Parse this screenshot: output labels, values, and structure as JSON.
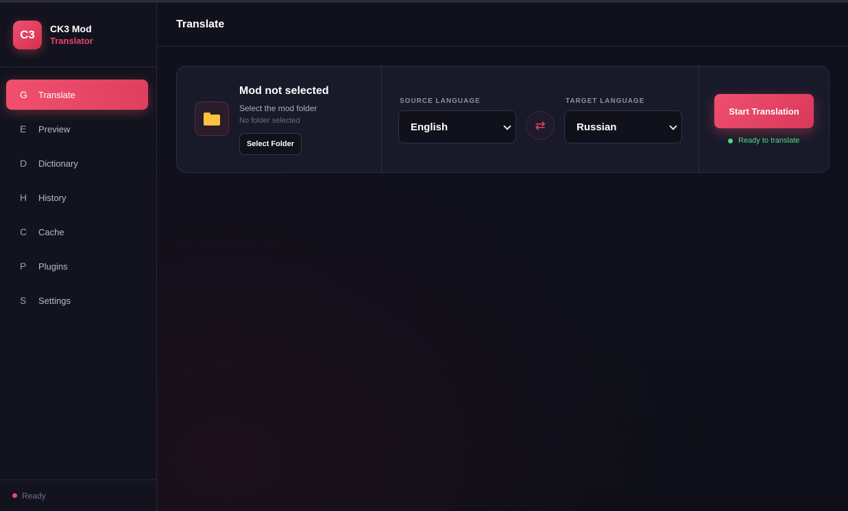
{
  "brand": {
    "logo_text": "C3",
    "name": "CK3 Mod",
    "subtitle": "Translator"
  },
  "nav": {
    "items": [
      {
        "icon": "G",
        "label": "Translate",
        "active": true
      },
      {
        "icon": "E",
        "label": "Preview"
      },
      {
        "icon": "D",
        "label": "Dictionary"
      },
      {
        "icon": "H",
        "label": "History"
      },
      {
        "icon": "C",
        "label": "Cache"
      },
      {
        "icon": "P",
        "label": "Plugins"
      },
      {
        "icon": "S",
        "label": "Settings"
      }
    ]
  },
  "footer": {
    "status": "Ready",
    "status_color": "#e8476a"
  },
  "header": {
    "title": "Translate"
  },
  "mod": {
    "icon": "folder-icon",
    "title": "Mod not selected",
    "subtitle": "Select the mod folder",
    "path": "No folder selected",
    "button_label": "Select Folder"
  },
  "languages": {
    "source_label": "SOURCE LANGUAGE",
    "source_value": "English",
    "target_label": "TARGET LANGUAGE",
    "target_value": "Russian",
    "swap_icon": "swap-arrows-icon"
  },
  "action": {
    "start_label": "Start Translation",
    "status": "Ready to translate",
    "status_color": "#4ade80",
    "accent": "#f0506e"
  }
}
